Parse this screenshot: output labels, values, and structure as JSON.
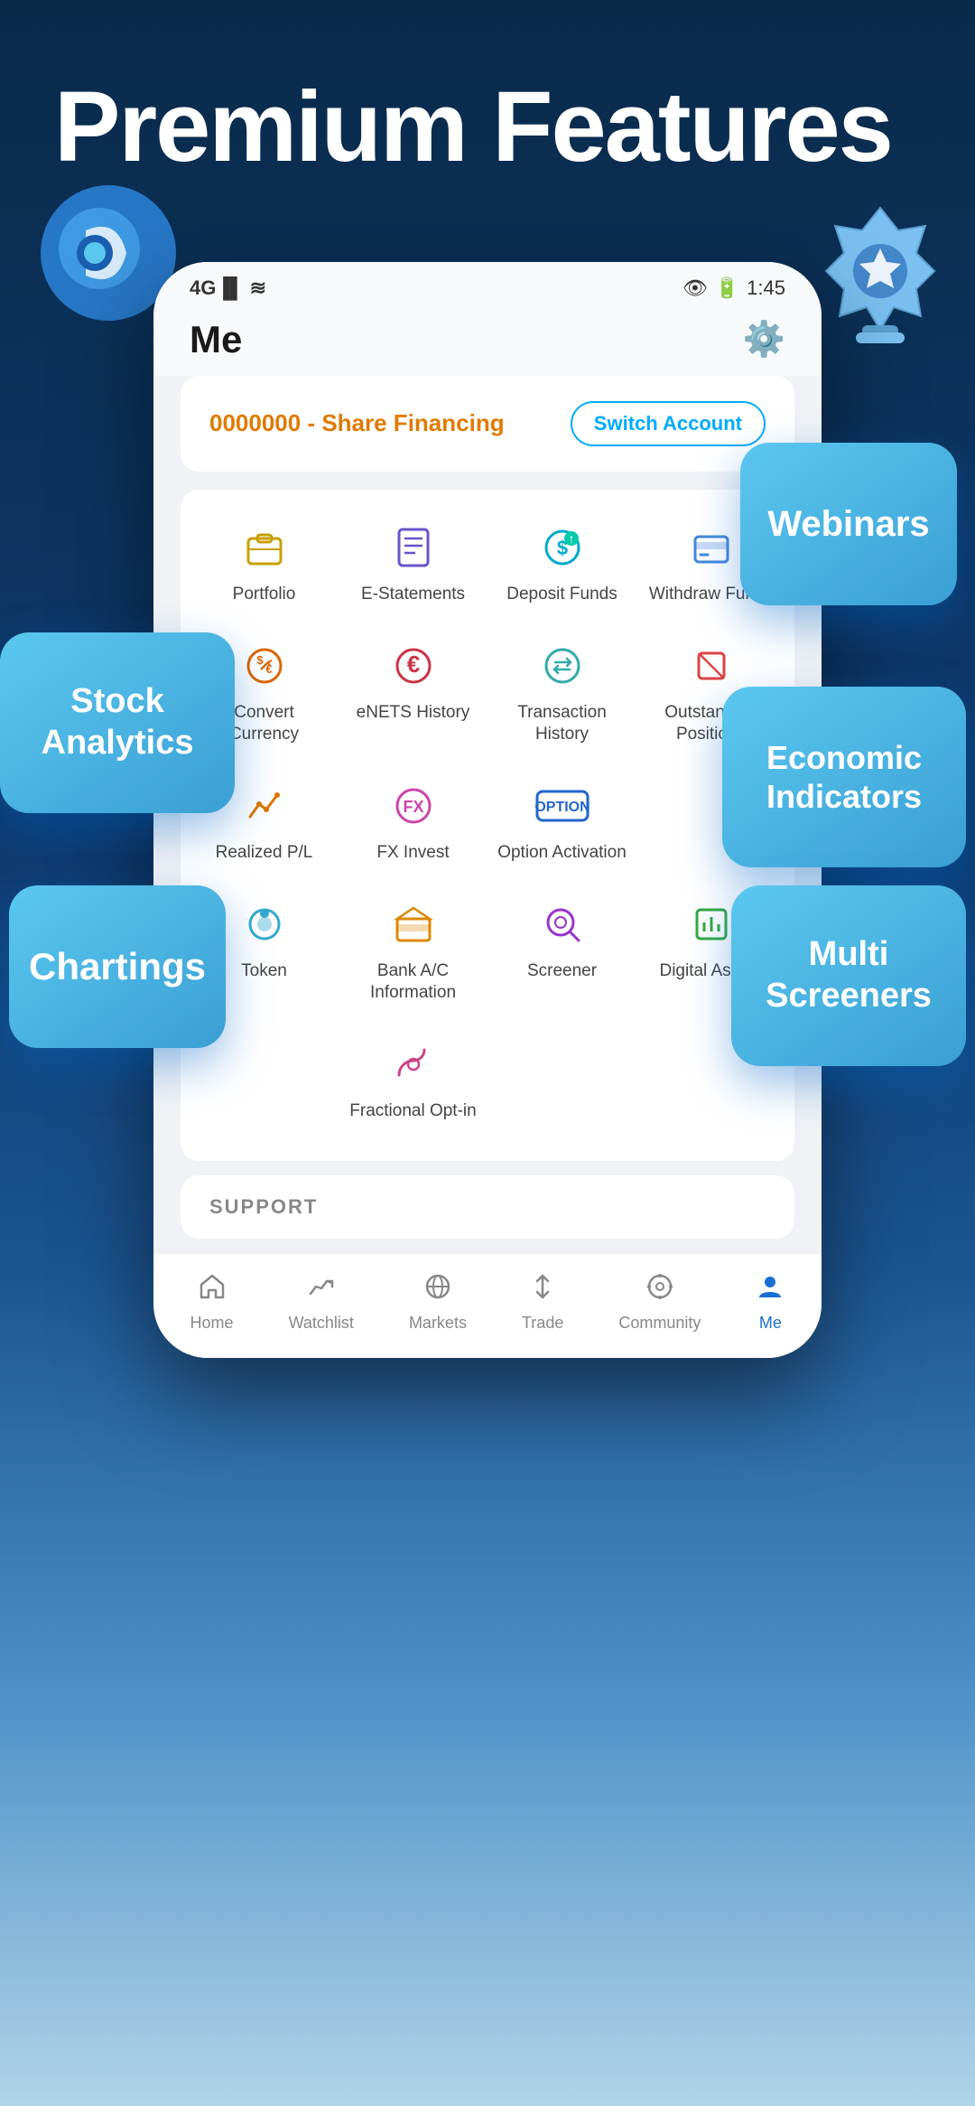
{
  "header": {
    "title": "Premium Features"
  },
  "status_bar": {
    "signal": "4G",
    "time": "1:45"
  },
  "app": {
    "title": "Me",
    "settings_label": "settings"
  },
  "account": {
    "name": "0000000 - Share Financing",
    "switch_label": "Switch Account"
  },
  "menu_rows": [
    [
      {
        "label": "Portfolio",
        "icon": "💼"
      },
      {
        "label": "E-Statements",
        "icon": "📄"
      },
      {
        "label": "Deposit Funds",
        "icon": "💰"
      },
      {
        "label": "Withdraw Funds",
        "icon": "🏦"
      }
    ],
    [
      {
        "label": "Convert Currency",
        "icon": "💱"
      },
      {
        "label": "eNETS History",
        "icon": "©"
      },
      {
        "label": "Transaction History",
        "icon": "🔄"
      },
      {
        "label": "Outstanding Positions",
        "icon": "📋"
      }
    ],
    [
      {
        "label": "Realized P/L",
        "icon": "📈"
      },
      {
        "label": "FX Invest",
        "icon": "💸"
      },
      {
        "label": "Option Activation",
        "icon": "OPTION"
      },
      {
        "label": ""
      }
    ],
    [
      {
        "label": "Token",
        "icon": "🔑"
      },
      {
        "label": "Bank A/C Information",
        "icon": "💳"
      },
      {
        "label": "Screener",
        "icon": "🔍"
      },
      {
        "label": "Digital Assets",
        "icon": "📊"
      }
    ],
    [
      {
        "label": "",
        "icon": ""
      },
      {
        "label": "Fractional Opt-in",
        "icon": "📉"
      },
      {
        "label": "",
        "icon": ""
      },
      {
        "label": "",
        "icon": ""
      }
    ]
  ],
  "support": {
    "label": "SUPPORT"
  },
  "bottom_nav": [
    {
      "label": "Home",
      "icon": "🏠",
      "active": false
    },
    {
      "label": "Watchlist",
      "icon": "📊",
      "active": false
    },
    {
      "label": "Markets",
      "icon": "🌐",
      "active": false
    },
    {
      "label": "Trade",
      "icon": "↕",
      "active": false
    },
    {
      "label": "Community",
      "icon": "⊙",
      "active": false
    },
    {
      "label": "Me",
      "icon": "👤",
      "active": true
    }
  ],
  "bubbles": {
    "webinars": "Webinars",
    "stock_analytics": "Stock Analytics",
    "economic_indicators": "Economic Indicators",
    "chartings": "Chartings",
    "multi_screeners": "Multi Screeners"
  }
}
